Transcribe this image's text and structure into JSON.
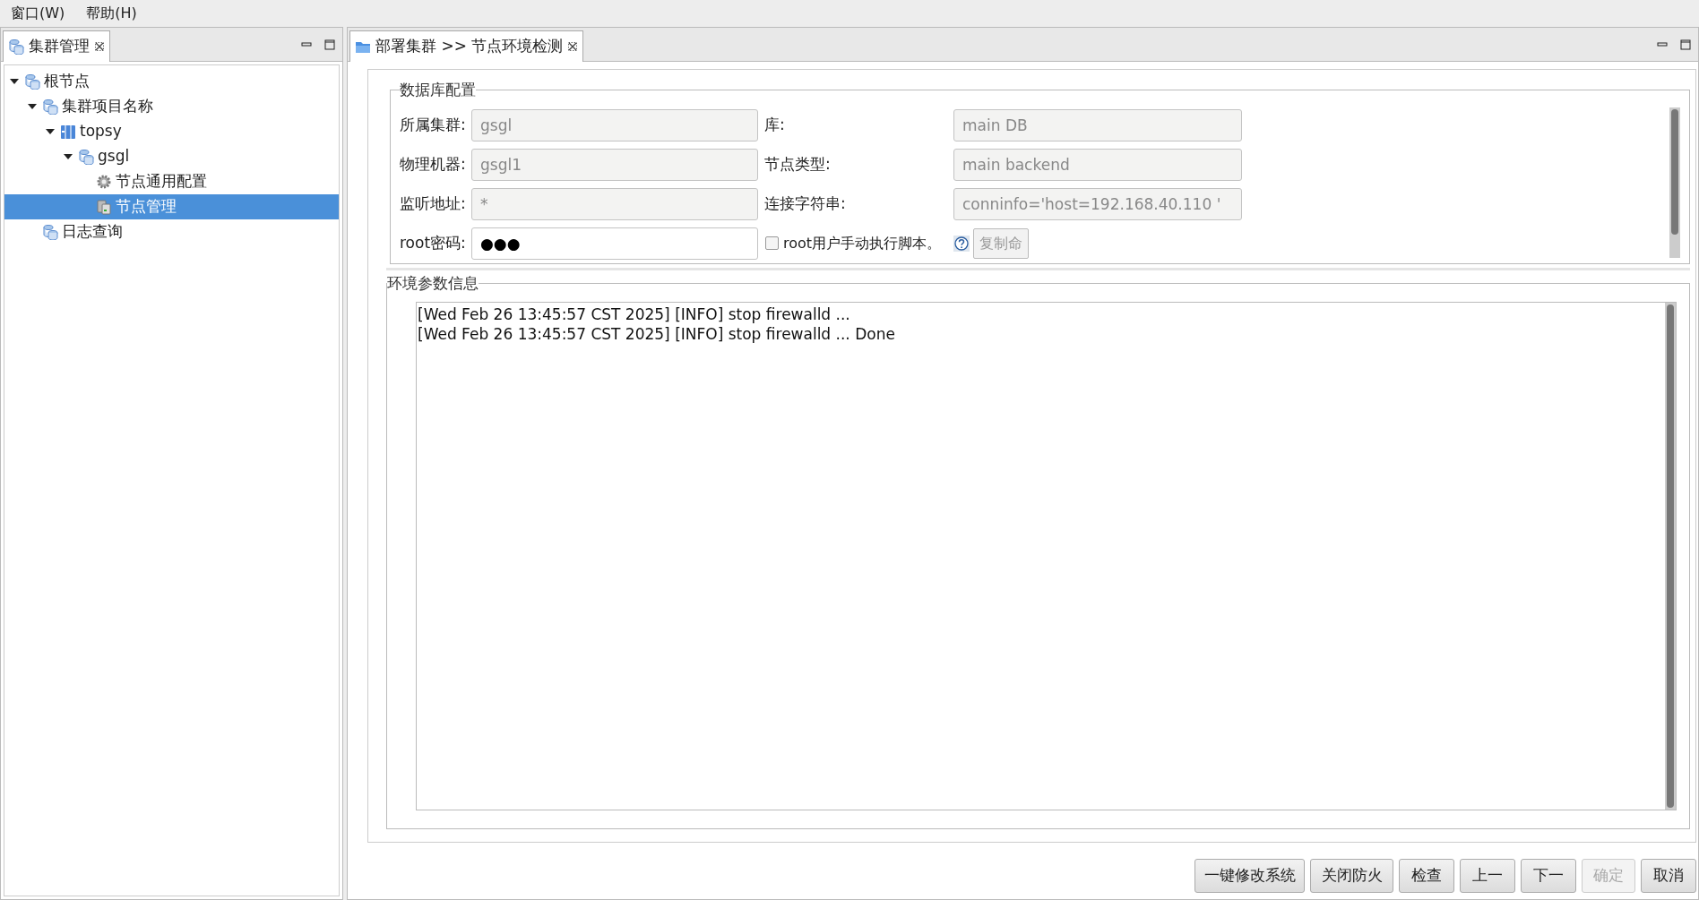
{
  "menu": [
    {
      "label": "窗口(W)"
    },
    {
      "label": "帮助(H)"
    }
  ],
  "left_panel": {
    "tab": {
      "label": "集群管理",
      "selected": true
    },
    "tree": [
      {
        "label": "根节点",
        "kind": "database",
        "expanded": true,
        "selected": false,
        "children": [
          {
            "label": "集群项目名称",
            "kind": "database",
            "expanded": true,
            "selected": false,
            "children": [
              {
                "label": "topsy",
                "kind": "server",
                "expanded": true,
                "selected": false,
                "children": [
                  {
                    "label": "gsgl",
                    "kind": "database",
                    "expanded": true,
                    "selected": false,
                    "children": [
                      {
                        "label": "节点通用配置",
                        "kind": "gear",
                        "selected": false
                      },
                      {
                        "label": "节点管理",
                        "kind": "node",
                        "selected": true
                      }
                    ]
                  }
                ]
              }
            ]
          },
          {
            "label": "日志查询",
            "kind": "database",
            "selected": false
          }
        ]
      }
    ]
  },
  "right_panel": {
    "tab": {
      "label": "部署集群 >> 节点环境检测",
      "selected": true
    },
    "db_config": {
      "title": "数据库配置",
      "rows": [
        {
          "left": {
            "label": "所属集群:",
            "value": "gsgl",
            "disabled": true
          },
          "right": {
            "label": "库:",
            "value": "main DB",
            "disabled": true
          }
        },
        {
          "left": {
            "label": "物理机器:",
            "value": "gsgl1",
            "disabled": true
          },
          "right": {
            "label": "节点类型:",
            "value": "main backend",
            "disabled": true
          }
        },
        {
          "left": {
            "label": "监听地址:",
            "value": "*",
            "disabled": true
          },
          "right": {
            "label": "连接字符串:",
            "value": "conninfo='host=192.168.40.110 '",
            "disabled": true
          }
        }
      ],
      "root_row": {
        "label": "root密码:",
        "value": "●●●",
        "disabled": false,
        "checkbox": {
          "label": "root用户手动执行脚本。",
          "checked": false
        },
        "copy_button": {
          "label": "复制命",
          "disabled": true
        }
      }
    },
    "env_info": {
      "title": "环境参数信息",
      "log": [
        "[Wed Feb 26 13:45:57 CST 2025] [INFO] stop firewalld ...",
        "[Wed Feb 26 13:45:57 CST 2025] [INFO] stop firewalld ... Done"
      ]
    },
    "buttons": [
      {
        "label": "一键修改系统",
        "disabled": false
      },
      {
        "label": "关闭防火",
        "disabled": false
      },
      {
        "label": "检查",
        "disabled": false
      },
      {
        "label": "上一",
        "disabled": false
      },
      {
        "label": "下一",
        "disabled": false
      },
      {
        "label": "确定",
        "disabled": true
      },
      {
        "label": "取消",
        "disabled": false
      }
    ]
  }
}
